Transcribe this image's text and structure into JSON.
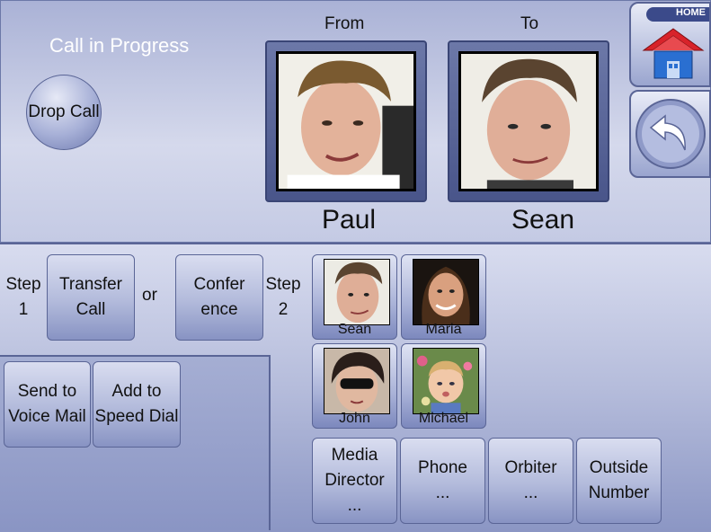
{
  "header": {
    "title": "Call in Progress",
    "from_label": "From",
    "to_label": "To",
    "from_name": "Paul",
    "to_name": "Sean"
  },
  "buttons": {
    "drop_call": "Drop Call",
    "home": "HOME",
    "home_icon": "house-icon",
    "back_icon": "back-arrow-icon"
  },
  "steps": {
    "step1_label": "Step",
    "step1_num": "1",
    "transfer_line1": "Transfer",
    "transfer_line2": "Call",
    "or_label": "or",
    "conference_line1": "Confer",
    "conference_line2": "ence",
    "step2_label": "Step",
    "step2_num": "2"
  },
  "actions": {
    "voicemail_line1": "Send to",
    "voicemail_line2": "Voice Mail",
    "speeddial_line1": "Add to",
    "speeddial_line2": "Speed Dial"
  },
  "contacts": [
    {
      "name": "Sean"
    },
    {
      "name": "Maria"
    },
    {
      "name": "John"
    },
    {
      "name": "Michael"
    }
  ],
  "destinations": {
    "media_line1": "Media",
    "media_line2": "Director",
    "media_line3": "...",
    "phone_line1": "Phone",
    "phone_line2": "...",
    "orbiter_line1": "Orbiter",
    "orbiter_line2": "...",
    "outside_line1": "Outside",
    "outside_line2": "Number"
  },
  "colors": {
    "accent": "#5a6596",
    "home_roof": "#d8232a",
    "home_body": "#2a6fd1"
  }
}
